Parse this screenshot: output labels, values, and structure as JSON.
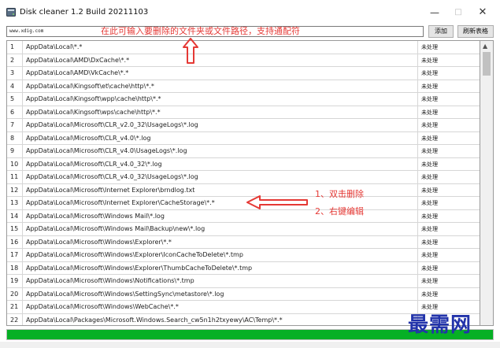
{
  "window": {
    "title": "Disk cleaner 1.2 Build 20211103"
  },
  "toolbar": {
    "input_value": "www.xdig.com",
    "add_label": "添加",
    "refresh_label": "刷新表格"
  },
  "annotations": {
    "top_hint": "在此可输入要删除的文件夹或文件路径，支持通配符",
    "hint1": "1、双击删除",
    "hint2": "2、右键编辑"
  },
  "table": {
    "rows": [
      {
        "num": "1",
        "path": "AppData\\Local\\*.*",
        "status": "未处理"
      },
      {
        "num": "2",
        "path": "AppData\\Local\\AMD\\DxCache\\*.*",
        "status": "未处理"
      },
      {
        "num": "3",
        "path": "AppData\\Local\\AMD\\VkCache\\*.*",
        "status": "未处理"
      },
      {
        "num": "4",
        "path": "AppData\\Local\\Kingsoft\\et\\cache\\http\\*.*",
        "status": "未处理"
      },
      {
        "num": "5",
        "path": "AppData\\Local\\Kingsoft\\wpp\\cache\\http\\*.*",
        "status": "未处理"
      },
      {
        "num": "6",
        "path": "AppData\\Local\\Kingsoft\\wps\\cache\\http\\*.*",
        "status": "未处理"
      },
      {
        "num": "7",
        "path": "AppData\\Local\\Microsoft\\CLR_v2.0_32\\UsageLogs\\*.log",
        "status": "未处理"
      },
      {
        "num": "8",
        "path": "AppData\\Local\\Microsoft\\CLR_v4.0\\*.log",
        "status": "未处理"
      },
      {
        "num": "9",
        "path": "AppData\\Local\\Microsoft\\CLR_v4.0\\UsageLogs\\*.log",
        "status": "未处理"
      },
      {
        "num": "10",
        "path": "AppData\\Local\\Microsoft\\CLR_v4.0_32\\*.log",
        "status": "未处理"
      },
      {
        "num": "11",
        "path": "AppData\\Local\\Microsoft\\CLR_v4.0_32\\UsageLogs\\*.log",
        "status": "未处理"
      },
      {
        "num": "12",
        "path": "AppData\\Local\\Microsoft\\Internet Explorer\\brndlog.txt",
        "status": "未处理"
      },
      {
        "num": "13",
        "path": "AppData\\Local\\Microsoft\\Internet Explorer\\CacheStorage\\*.*",
        "status": "未处理"
      },
      {
        "num": "14",
        "path": "AppData\\Local\\Microsoft\\Windows Mail\\*.log",
        "status": "未处理"
      },
      {
        "num": "15",
        "path": "AppData\\Local\\Microsoft\\Windows Mail\\Backup\\new\\*.log",
        "status": "未处理"
      },
      {
        "num": "16",
        "path": "AppData\\Local\\Microsoft\\Windows\\Explorer\\*.*",
        "status": "未处理"
      },
      {
        "num": "17",
        "path": "AppData\\Local\\Microsoft\\Windows\\Explorer\\IconCacheToDelete\\*.tmp",
        "status": "未处理"
      },
      {
        "num": "18",
        "path": "AppData\\Local\\Microsoft\\Windows\\Explorer\\ThumbCacheToDelete\\*.tmp",
        "status": "未处理"
      },
      {
        "num": "19",
        "path": "AppData\\Local\\Microsoft\\Windows\\Notifications\\*.tmp",
        "status": "未处理"
      },
      {
        "num": "20",
        "path": "AppData\\Local\\Microsoft\\Windows\\SettingSync\\metastore\\*.log",
        "status": "未处理"
      },
      {
        "num": "21",
        "path": "AppData\\Local\\Microsoft\\Windows\\WebCache\\*.*",
        "status": "未处理"
      },
      {
        "num": "22",
        "path": "AppData\\Local\\Packages\\Microsoft.Windows.Search_cw5n1h2txyewy\\AC\\Temp\\*.*",
        "status": ""
      }
    ]
  },
  "progress": {
    "value": 1.0,
    "color": "#06b025"
  },
  "watermark": {
    "text": "最需网"
  },
  "colors": {
    "annotation": "#e53935",
    "watermark": "#2233aa"
  }
}
